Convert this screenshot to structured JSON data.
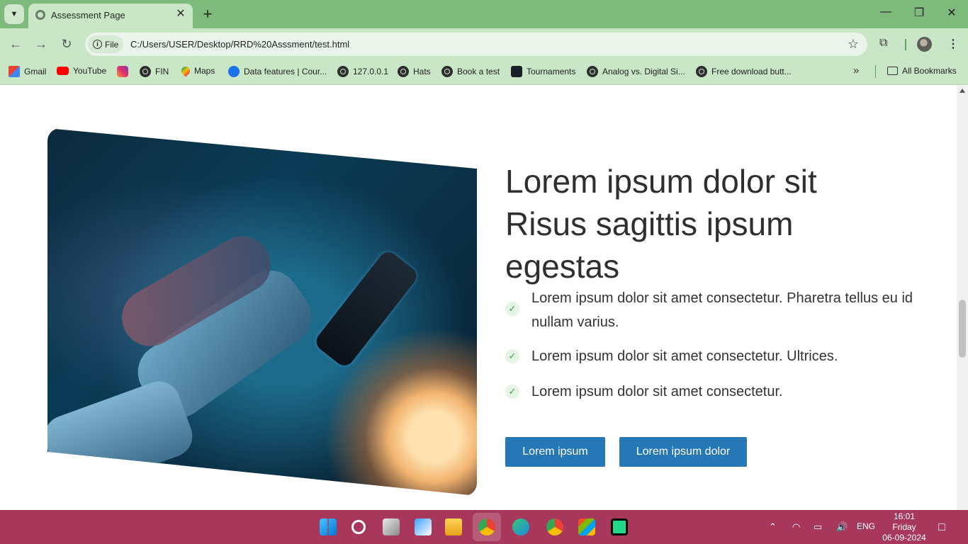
{
  "browser": {
    "tab_title": "Assessment Page",
    "site_chip": "File",
    "url": "C:/Users/USER/Desktop/RRD%20Asssment/test.html",
    "bookmarks": [
      {
        "label": "Gmail",
        "icon": "gmail-icon"
      },
      {
        "label": "YouTube",
        "icon": "youtube-icon"
      },
      {
        "label": "",
        "icon": "instagram-icon"
      },
      {
        "label": "FIN",
        "icon": "globe-icon"
      },
      {
        "label": "Maps",
        "icon": "maps-icon"
      },
      {
        "label": "Data features | Cour...",
        "icon": "coursera-icon"
      },
      {
        "label": "127.0.0.1",
        "icon": "globe-icon"
      },
      {
        "label": "Hats",
        "icon": "globe-icon"
      },
      {
        "label": "Book a test",
        "icon": "globe-icon"
      },
      {
        "label": "Tournaments",
        "icon": "react-icon"
      },
      {
        "label": "Analog vs. Digital Si...",
        "icon": "globe-icon"
      },
      {
        "label": "Free download butt...",
        "icon": "globe-icon"
      }
    ],
    "all_bookmarks": "All Bookmarks"
  },
  "page": {
    "headline": "Lorem ipsum dolor sit Risus sagittis ipsum egestas",
    "features": [
      "Lorem ipsum dolor sit amet consectetur. Pharetra tellus eu id nullam varius.",
      "Lorem ipsum dolor sit amet consectetur. Ultrices.",
      "Lorem ipsum dolor sit amet consectetur."
    ],
    "primary_button": "Lorem ipsum",
    "secondary_button": "Lorem ipsum dolor",
    "accent_color": "#2577b5"
  },
  "taskbar": {
    "language": "ENG",
    "time": "16:01",
    "day": "Friday",
    "date": "06-09-2024",
    "color": "#a8375c"
  }
}
